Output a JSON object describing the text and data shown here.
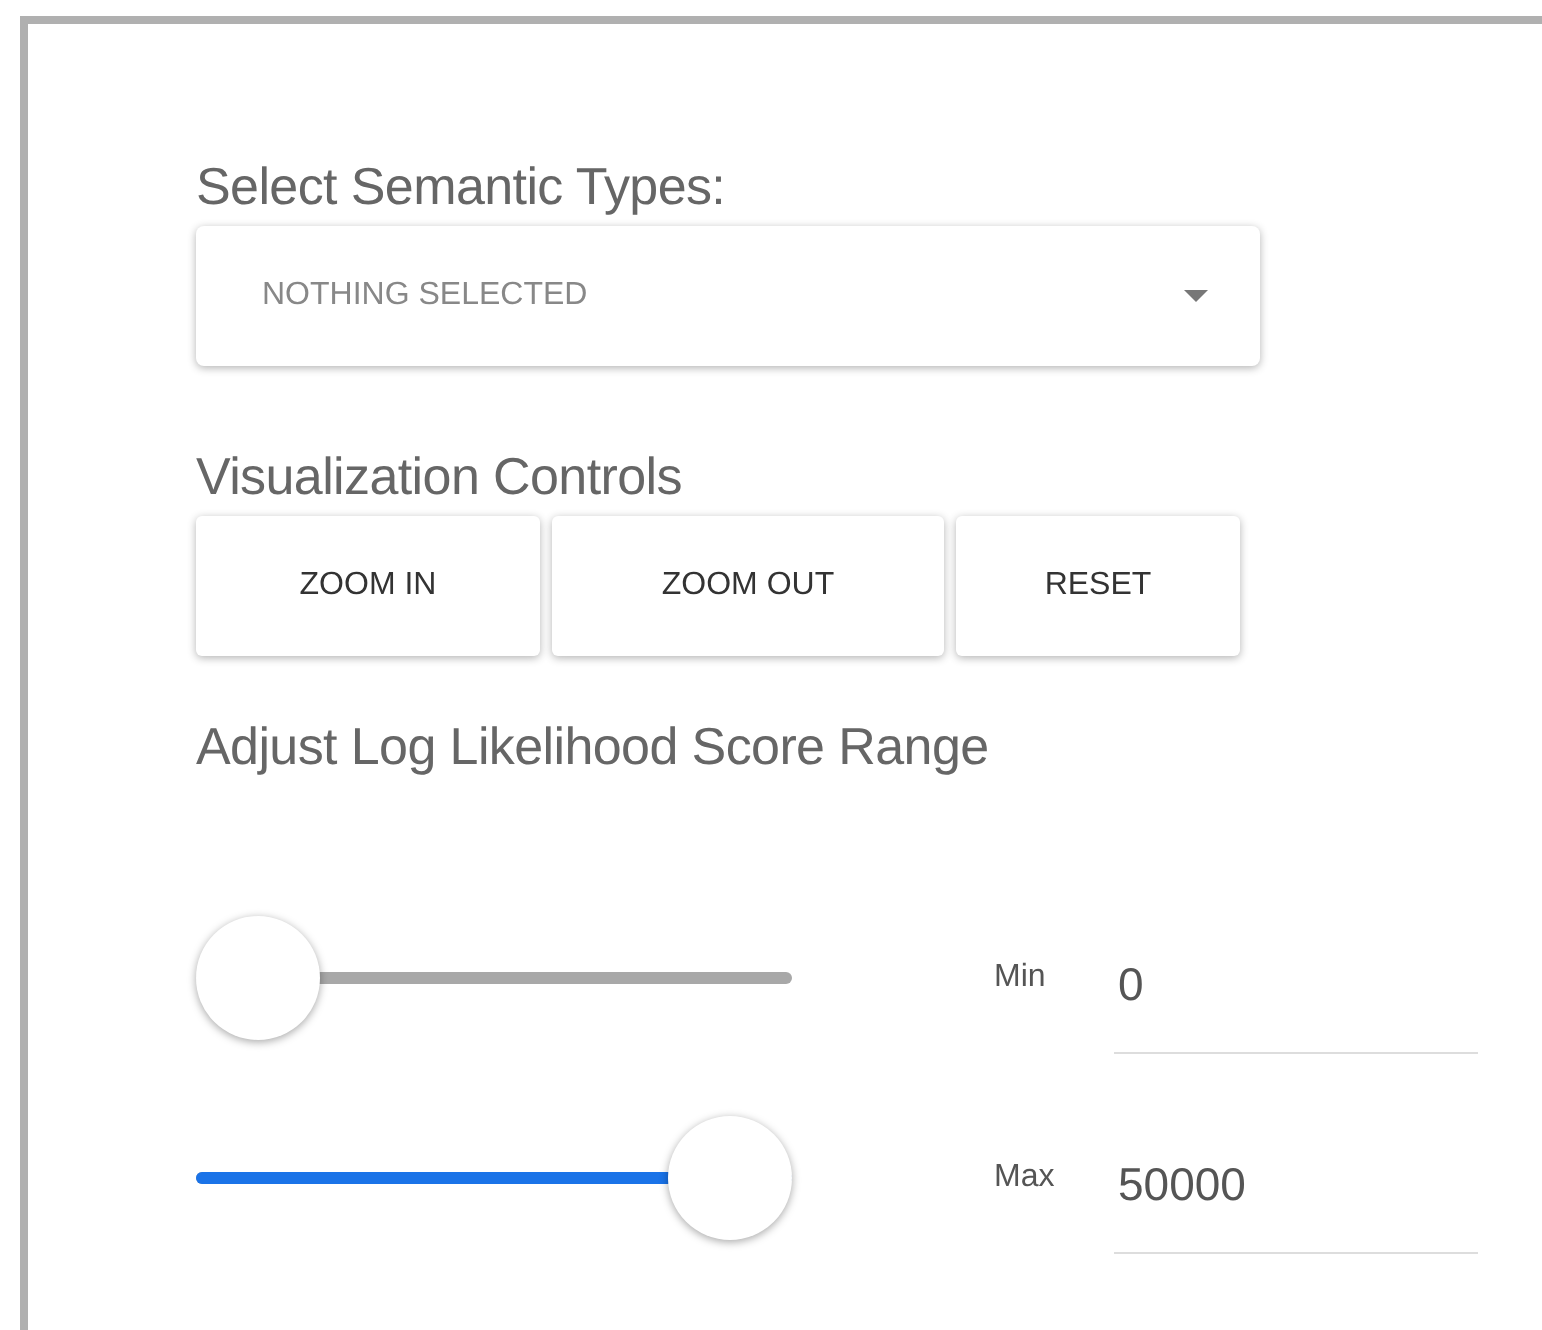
{
  "semantic_types": {
    "heading": "Select Semantic Types:",
    "dropdown": {
      "value": "NOTHING SELECTED"
    }
  },
  "visualization_controls": {
    "heading": "Visualization Controls",
    "buttons": [
      "ZOOM IN",
      "ZOOM OUT",
      "RESET"
    ]
  },
  "score_range": {
    "heading": "Adjust Log Likelihood Score Range",
    "sliders": [
      {
        "label": "Min",
        "value": "0",
        "level": 0
      },
      {
        "label": "Max",
        "value": "50000",
        "level": 1
      }
    ]
  }
}
